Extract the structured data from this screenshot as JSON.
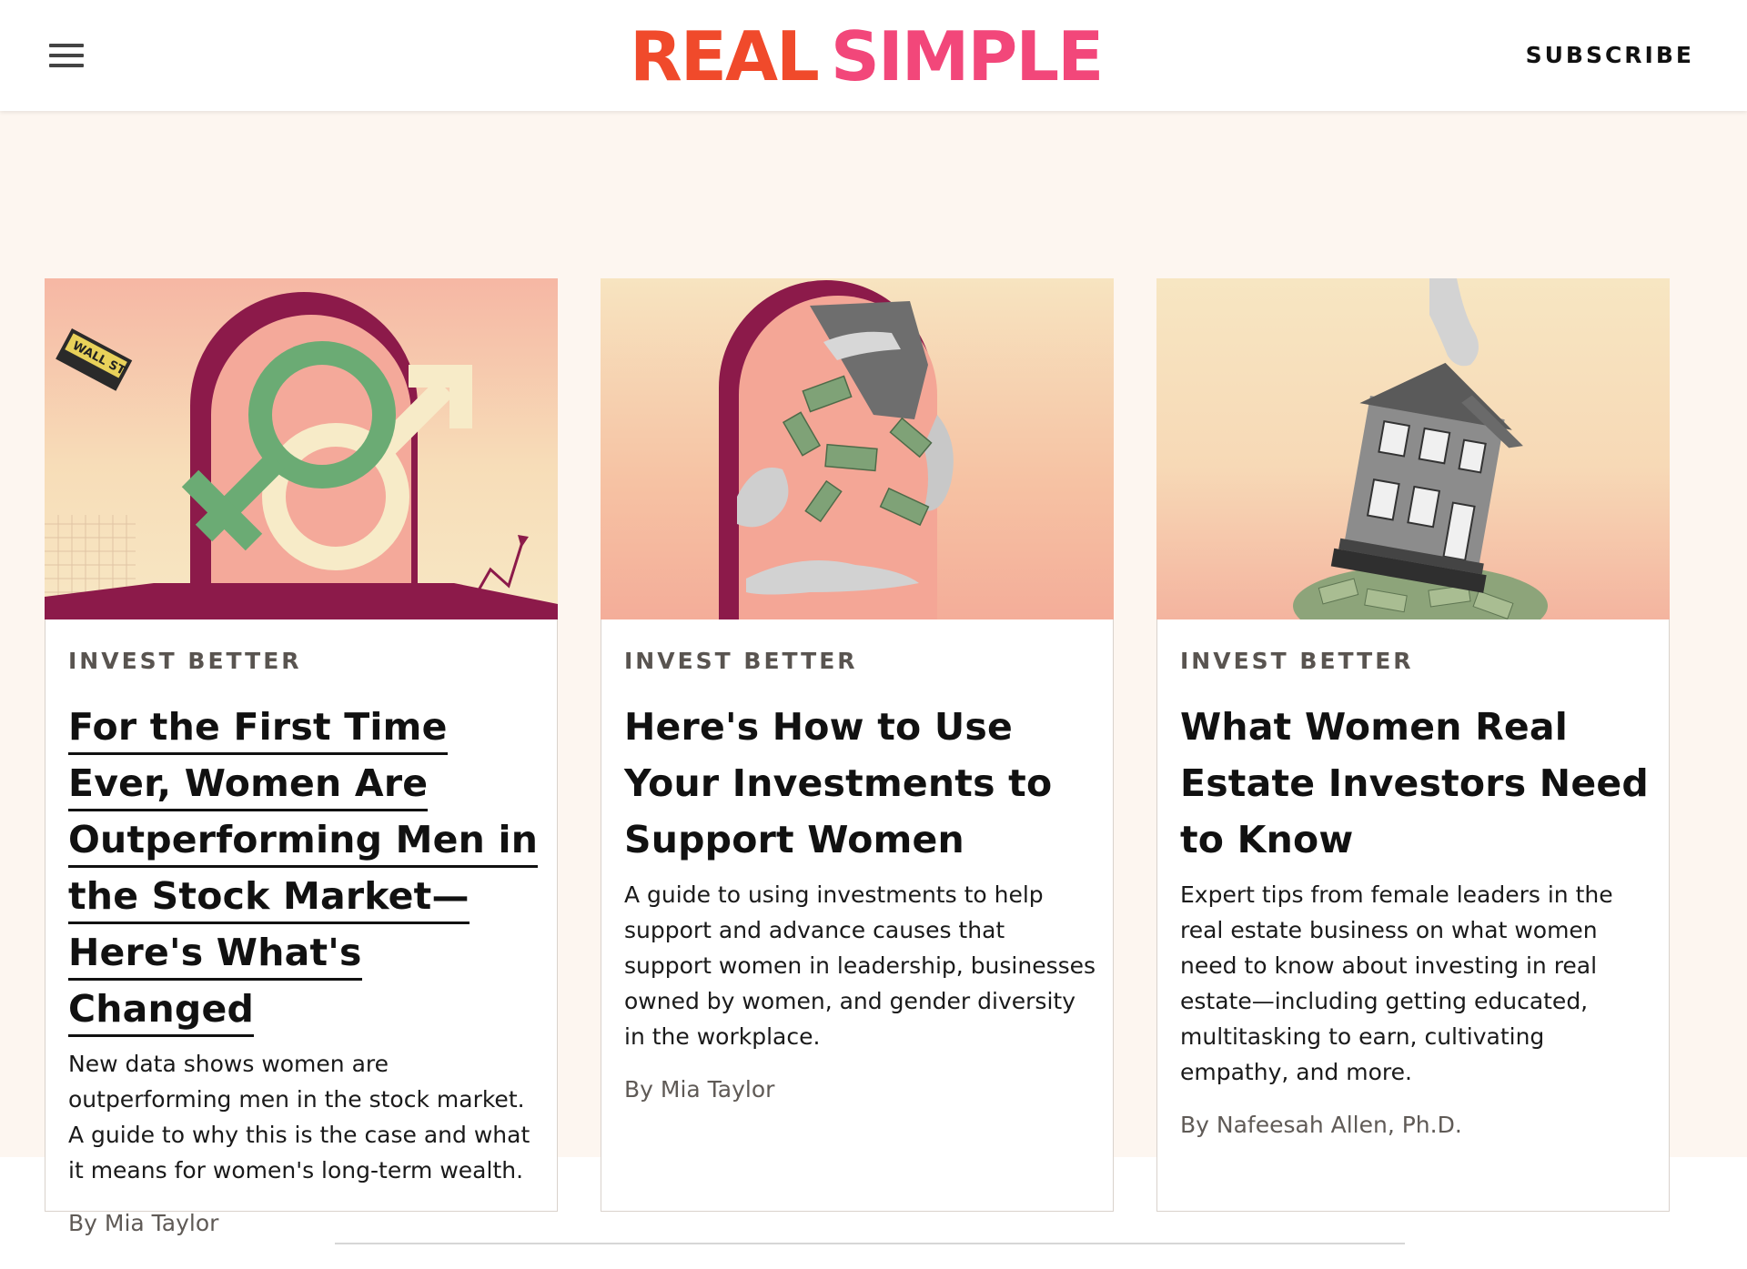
{
  "header": {
    "menu_icon": "hamburger-menu-icon",
    "logo_part1": "REAL",
    "logo_part2": "SIMPLE",
    "subscribe_label": "SUBSCRIBE",
    "colors": {
      "logo_red": "#f04a2b",
      "logo_pink": "#f2477a"
    }
  },
  "cards": [
    {
      "kicker": "INVEST BETTER",
      "title": "For the First Time Ever, Women Are Outperforming Men in the Stock Market—Here's What's Changed",
      "description": "New data shows women are outperforming men in the stock market. A guide to why this is the case and what it means for women's long-term wealth.",
      "byline": "By Mia Taylor",
      "image_sign_text": "WALL ST"
    },
    {
      "kicker": "INVEST BETTER",
      "title": "Here's How to Use Your Investments to Support Women",
      "description": "A guide to using investments to help support and advance causes that support women in leadership, businesses owned by women, and gender diversity in the workplace.",
      "byline": "By Mia Taylor"
    },
    {
      "kicker": "INVEST BETTER",
      "title": "What Women Real Estate Investors Need to Know",
      "description": "Expert tips from female leaders in the real estate business on what women need to know about investing in real estate—including getting educated, multitasking to earn, cultivating empathy, and more.",
      "byline": "By Nafeesah Allen, Ph.D."
    }
  ]
}
